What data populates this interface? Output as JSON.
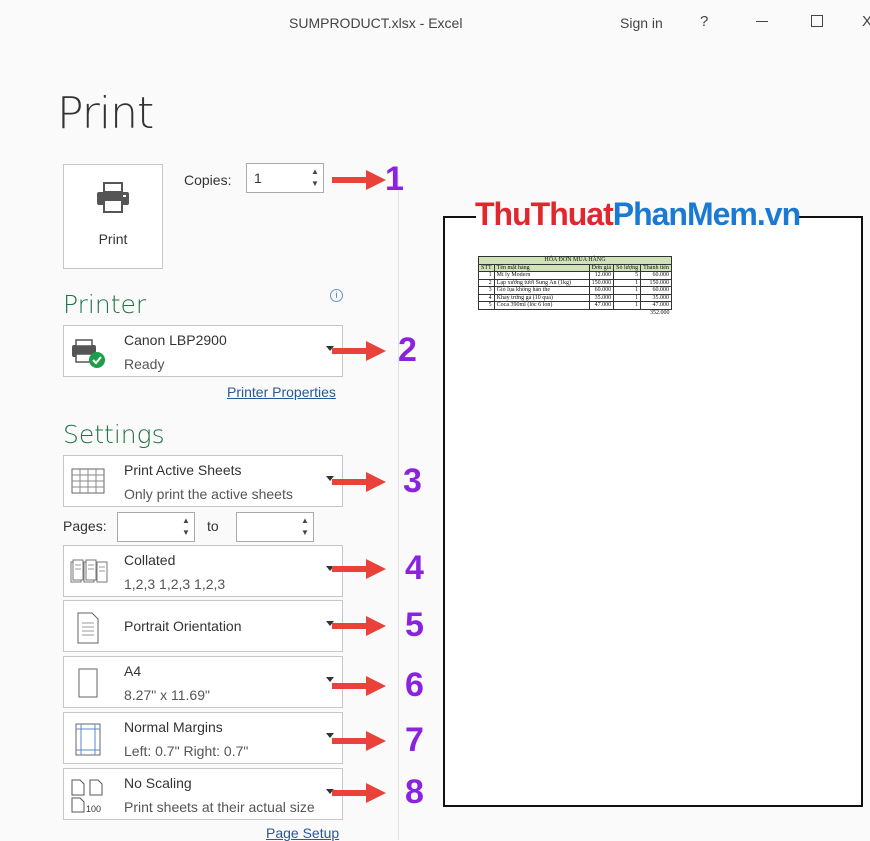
{
  "window": {
    "title": "SUMPRODUCT.xlsx  -  Excel",
    "sign_in": "Sign in",
    "help": "?",
    "close": "X"
  },
  "heading": "Print",
  "print_button": {
    "label": "Print"
  },
  "copies": {
    "label": "Copies:",
    "value": "1"
  },
  "printer": {
    "section_title": "Printer",
    "name": "Canon LBP2900",
    "status": "Ready",
    "properties_link": "Printer Properties"
  },
  "settings": {
    "section_title": "Settings",
    "what": {
      "title": "Print Active Sheets",
      "subtitle": "Only print the active sheets"
    },
    "pages_label": "Pages:",
    "to_label": "to",
    "collation": {
      "title": "Collated",
      "subtitle": "1,2,3    1,2,3    1,2,3"
    },
    "orientation": {
      "title": "Portrait Orientation"
    },
    "paper": {
      "title": "A4",
      "subtitle": "8.27\" x 11.69\""
    },
    "margins": {
      "title": "Normal Margins",
      "subtitle": "Left:  0.7\"    Right:  0.7\""
    },
    "scaling": {
      "title": "No Scaling",
      "subtitle": "Print sheets at their actual size"
    },
    "page_setup_link": "Page Setup"
  },
  "callouts": [
    "1",
    "2",
    "3",
    "4",
    "5",
    "6",
    "7",
    "8"
  ],
  "watermark": {
    "part1": "ThuThuat",
    "part2": "PhanMem",
    "part3": ".vn"
  },
  "preview_invoice": {
    "title": "HÓA ĐƠN MUA HÀNG",
    "headers": [
      "STT",
      "Tên mặt hàng",
      "Đơn giá",
      "Số lượng",
      "Thành tiền"
    ],
    "rows": [
      [
        "1",
        "Mì ly Modern",
        "12.000",
        "5",
        "60.000"
      ],
      [
        "2",
        "Lạp xưởng tươi Sung An (1kg)",
        "150.000",
        "1",
        "150.000"
      ],
      [
        "3",
        "Giò lụa không hàn the",
        "60.000",
        "1",
        "60.000"
      ],
      [
        "4",
        "Khay trứng gà (10 quả)",
        "35.000",
        "1",
        "35.000"
      ],
      [
        "5",
        "Coca 390ml (lốc 6 lon)",
        "47.000",
        "1",
        "47.000"
      ]
    ],
    "total": "352.000"
  },
  "colors": {
    "accent_green": "#217346",
    "callout_purple": "#8b22e0",
    "arrow_red": "#e8423a"
  }
}
